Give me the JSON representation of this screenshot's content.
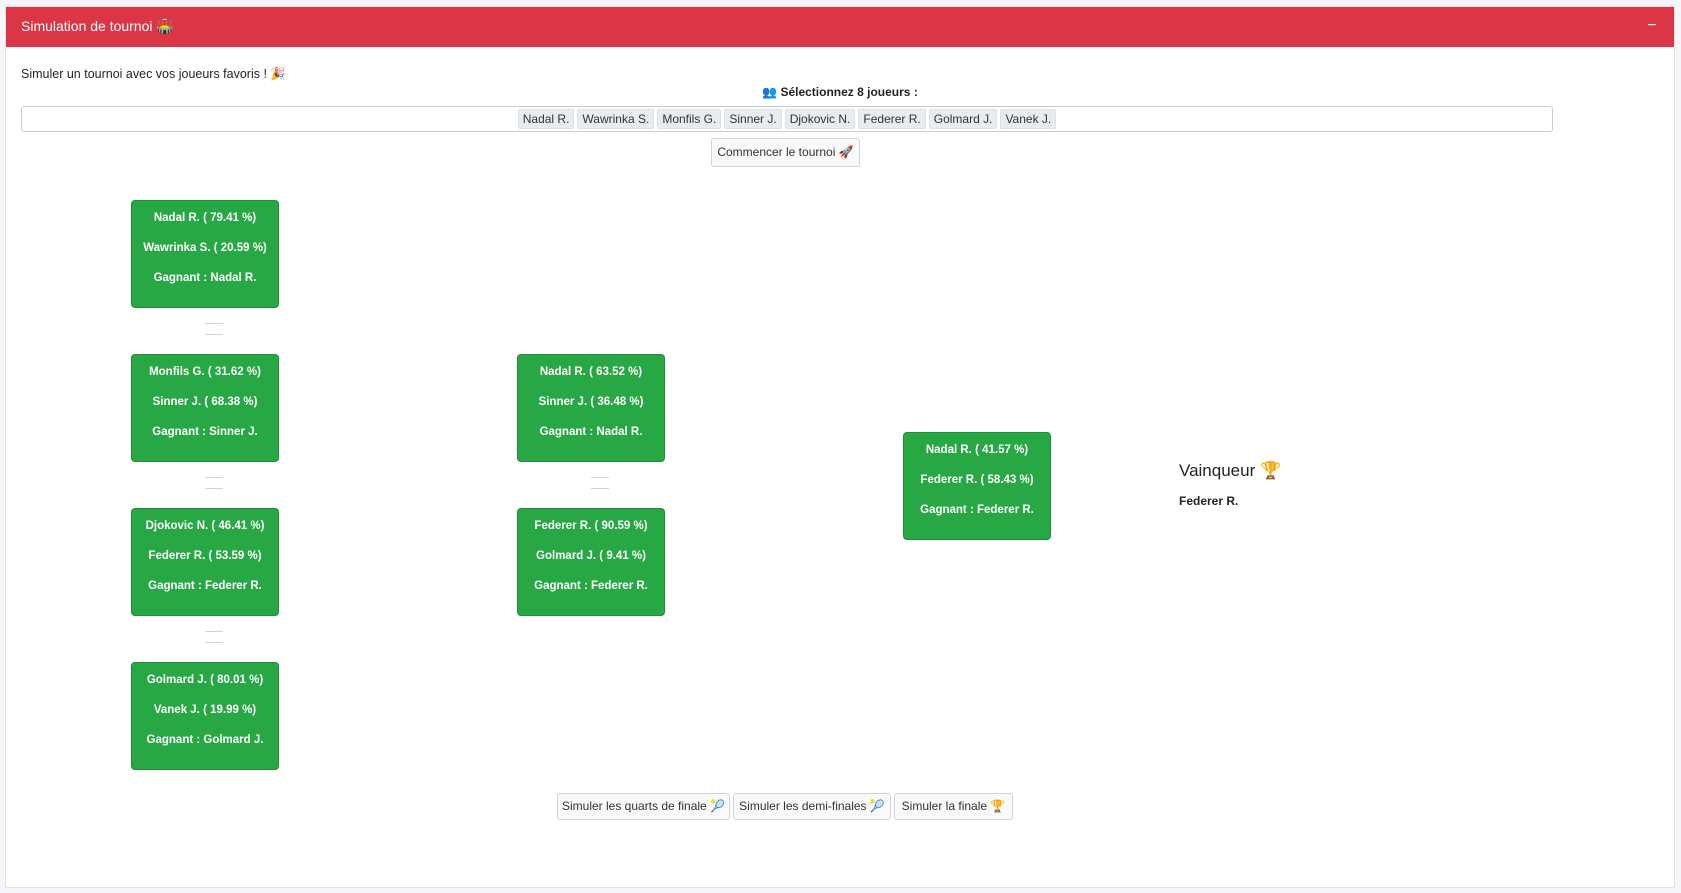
{
  "header": {
    "title": "Simulation de tournoi 🏟️",
    "collapse_label": "−",
    "accent_color": "#dc3545"
  },
  "intro": "Simuler un tournoi avec vos joueurs favoris ! 🎉",
  "select_label": "👥 Sélectionnez 8 joueurs :",
  "selected_players": [
    "Nadal R.",
    "Wawrinka S.",
    "Monfils G.",
    "Sinner J.",
    "Djokovic N.",
    "Federer R.",
    "Golmard J.",
    "Vanek J."
  ],
  "start_button": "Commencer le tournoi 🚀",
  "match_color": "#28a745",
  "quarterfinals": [
    {
      "p1": "Nadal R. ( 79.41 %)",
      "p2": "Wawrinka S. ( 20.59 %)",
      "winner": "Gagnant : Nadal R."
    },
    {
      "p1": "Monfils G. ( 31.62 %)",
      "p2": "Sinner J. ( 68.38 %)",
      "winner": "Gagnant : Sinner J."
    },
    {
      "p1": "Djokovic N. ( 46.41 %)",
      "p2": "Federer R. ( 53.59 %)",
      "winner": "Gagnant : Federer R."
    },
    {
      "p1": "Golmard J. ( 80.01 %)",
      "p2": "Vanek J. ( 19.99 %)",
      "winner": "Gagnant : Golmard J."
    }
  ],
  "semifinals": [
    {
      "p1": "Nadal R. ( 63.52 %)",
      "p2": "Sinner J. ( 36.48 %)",
      "winner": "Gagnant : Nadal R."
    },
    {
      "p1": "Federer R. ( 90.59 %)",
      "p2": "Golmard J. ( 9.41 %)",
      "winner": "Gagnant : Federer R."
    }
  ],
  "final": {
    "p1": "Nadal R. ( 41.57 %)",
    "p2": "Federer R. ( 58.43 %)",
    "winner": "Gagnant : Federer R."
  },
  "champion": {
    "title": "Vainqueur 🏆",
    "name": "Federer R."
  },
  "sim_buttons": {
    "quarters": "Simuler les quarts de finale 🎾",
    "semis": "Simuler les demi-finales 🎾",
    "final": "Simuler la finale 🏆"
  }
}
